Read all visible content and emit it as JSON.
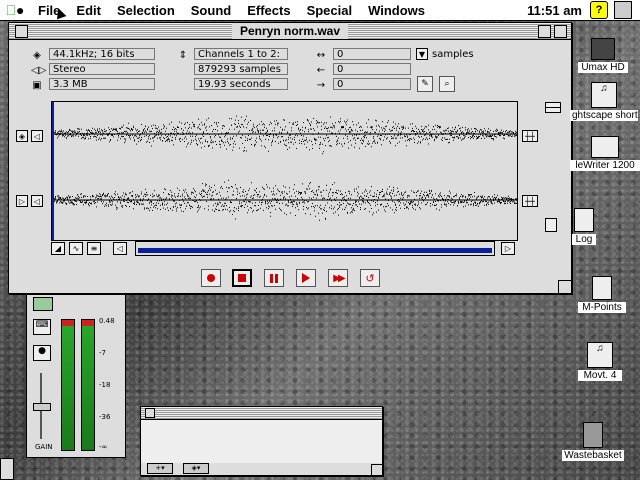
{
  "menubar": {
    "items": [
      "File",
      "Edit",
      "Selection",
      "Sound",
      "Effects",
      "Special",
      "Windows"
    ],
    "clock": "11:51 am"
  },
  "main_window": {
    "title": "Penryn norm.wav",
    "info": {
      "rate": "44.1kHz; 16 bits",
      "channels_mode": "Stereo",
      "size": "3.3 MB",
      "channels": "Channels 1 to 2:",
      "samples": "879293 samples",
      "seconds": "19.93 seconds",
      "sel_start": "0",
      "sel_end": "0",
      "sel_len": "0",
      "unit": "samples"
    },
    "scroll_position": 0.02,
    "transport": [
      "record",
      "stop",
      "pause",
      "play",
      "fast-forward",
      "loop"
    ]
  },
  "mixer": {
    "scale": [
      "0.48",
      "-7",
      "-18",
      "-36",
      "-∞"
    ],
    "gain_label": "GAIN"
  },
  "desktop_icons": [
    {
      "label": "Umax HD"
    },
    {
      "label": "ghtscape short"
    },
    {
      "label": "leWriter 1200"
    },
    {
      "label": "Log"
    },
    {
      "label": "M-Points"
    },
    {
      "label": "Movt. 4"
    },
    {
      "label": "Wastebasket"
    }
  ],
  "colors": {
    "record_red": "#cc0000",
    "track_blue": "#0a1f9c",
    "meter_green": "#2aa82a",
    "meter_red": "#cc2222"
  }
}
